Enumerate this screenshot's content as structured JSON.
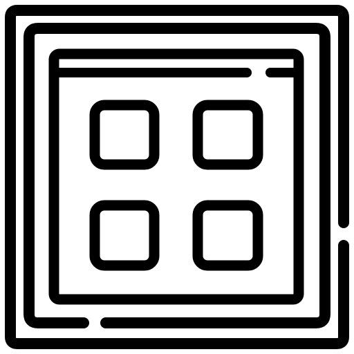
{
  "icon": {
    "name": "app-grid-window-icon",
    "stroke_color": "#000000",
    "background_color": "#ffffff",
    "grid": {
      "rows": 2,
      "columns": 2
    }
  }
}
